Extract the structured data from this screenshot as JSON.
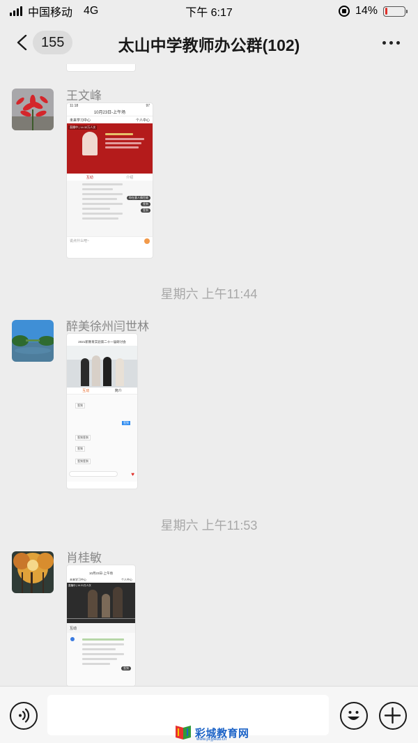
{
  "status_bar": {
    "carrier": "中国移动",
    "network": "4G",
    "time": "下午 6:17",
    "battery": "14%",
    "battery_level": 0.14
  },
  "nav": {
    "unread_count": "155",
    "title": "太山中学教师办公群(102)"
  },
  "messages": [
    {
      "sender": "王文峰",
      "screenshot": {
        "status_time": "11:18",
        "status_right": "97",
        "title": "10月23日-上午场",
        "sub_left": "未来学习中心",
        "sub_right": "个人中心",
        "banner_tag": "直播中 | 14.32万人次",
        "tab_left": "互动",
        "tab_right": "介绍",
        "input_placeholder": "说点什么吧~",
        "chips": [
          "你在意人情世故",
          "签到",
          "签到"
        ]
      }
    },
    {
      "time_separator": "星期六 上午11:44"
    },
    {
      "sender": "醉美徐州闫世林",
      "screenshot": {
        "title": "2021新教育实验第二十一届研讨会",
        "tab_left": "互动",
        "tab_right": "简介",
        "replies": [
          "签到",
          "签到签到",
          "签到",
          "签到签到"
        ],
        "reply_right": "签到"
      }
    },
    {
      "time_separator": "星期六 上午11:53"
    },
    {
      "sender": "肖桂敏",
      "screenshot": {
        "title": "10月23日-上午场",
        "sub_left": "未来学习中心",
        "sub_right": "个人中心",
        "video_tag": "直播中 | 14.31万人次",
        "tab": "互动",
        "chip": "签到"
      }
    }
  ],
  "input": {
    "placeholder": ""
  },
  "watermark": {
    "text": "彩城教育网",
    "url": "www.pcjyedu.cn"
  },
  "colors": {
    "background": "#ededed",
    "accent_red": "#b41b1b",
    "battery_low": "#e0302a",
    "watermark_blue": "#1c63c7"
  }
}
